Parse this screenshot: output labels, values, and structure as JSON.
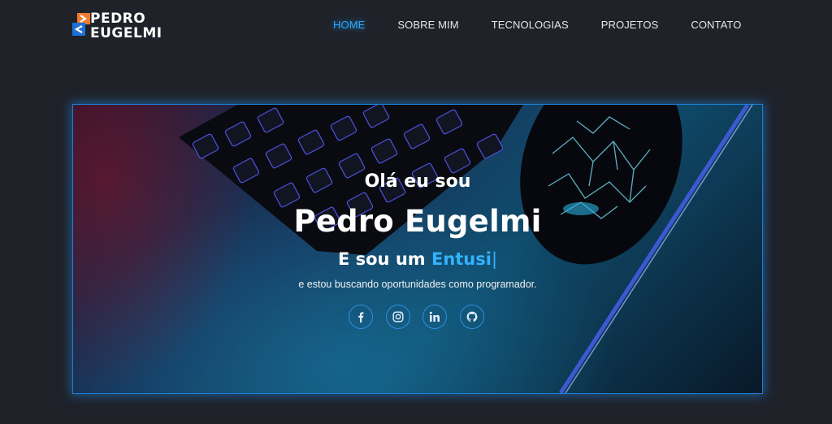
{
  "logo": {
    "line1": "PEDRO",
    "line2": "EUGELMI"
  },
  "nav": [
    {
      "label": "HOME",
      "active": true
    },
    {
      "label": "SOBRE MIM",
      "active": false
    },
    {
      "label": "TECNOLOGIAS",
      "active": false
    },
    {
      "label": "PROJETOS",
      "active": false
    },
    {
      "label": "CONTATO",
      "active": false
    }
  ],
  "hero": {
    "greeting": "Olá eu sou",
    "name": "Pedro Eugelmi",
    "role_prefix": "E sou um",
    "role_typed": "Entusi",
    "cursor": "|",
    "description": "e estou buscando oportunidades como programador."
  },
  "socials": [
    {
      "icon": "facebook-icon"
    },
    {
      "icon": "instagram-icon"
    },
    {
      "icon": "linkedin-icon"
    },
    {
      "icon": "github-icon"
    }
  ],
  "colors": {
    "background": "#1f2229",
    "accent": "#29a8ff",
    "logo_orange": "#f07a2c",
    "logo_blue": "#1e6fd8"
  }
}
